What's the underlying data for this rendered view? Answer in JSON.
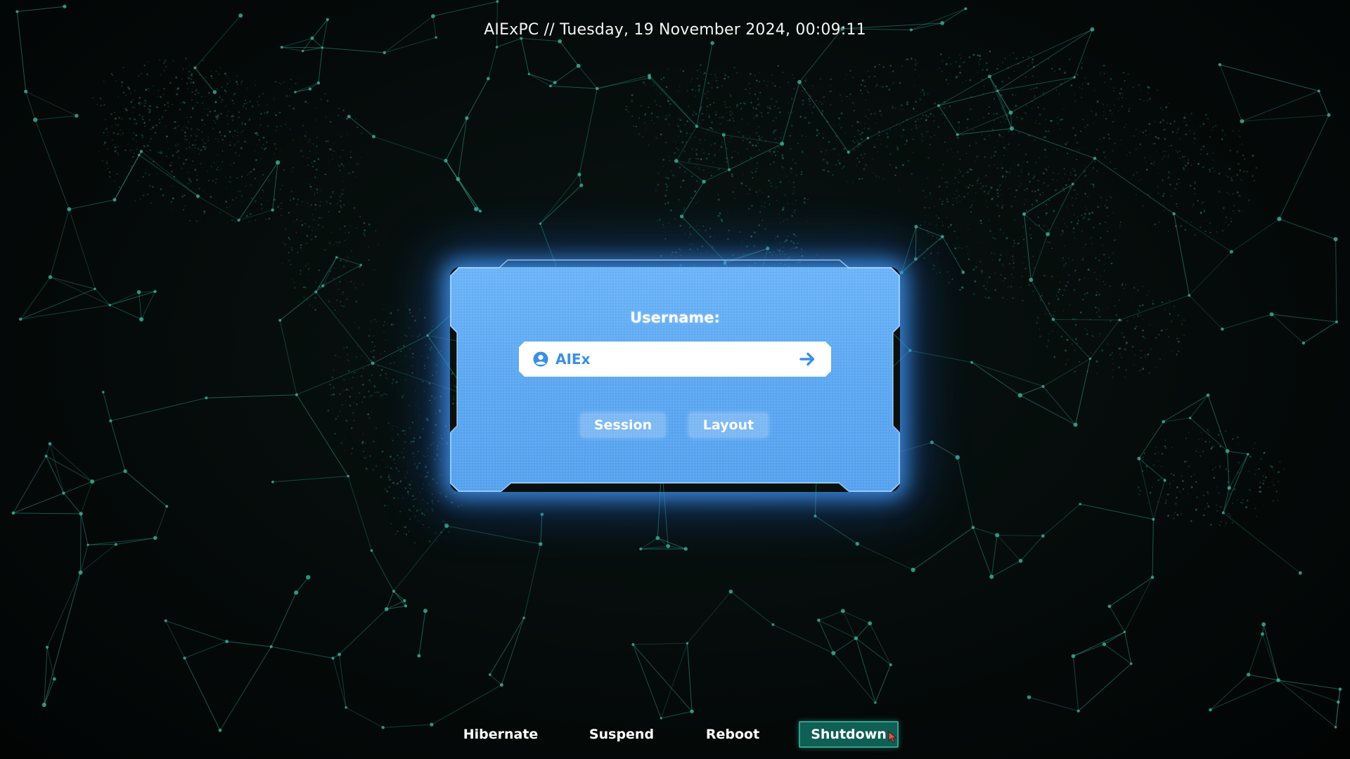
{
  "header": {
    "clock_text": "AIExPC // Tuesday, 19 November 2024, 00:09:11"
  },
  "login": {
    "username_label": "Username:",
    "username_value": "AIEx",
    "user_icon": "user-circle-icon",
    "submit_icon": "arrow-right-icon",
    "session_label": "Session",
    "layout_label": "Layout"
  },
  "power": {
    "hibernate_label": "Hibernate",
    "suspend_label": "Suspend",
    "reboot_label": "Reboot",
    "shutdown_label": "Shutdown"
  },
  "theme": {
    "panel_color": "#5aa6f1",
    "glow_color": "#46a0ff",
    "accent_text": "#3a8fe6",
    "network_color": "#2fa38f",
    "shutdown_bg": "#0f5f54"
  }
}
